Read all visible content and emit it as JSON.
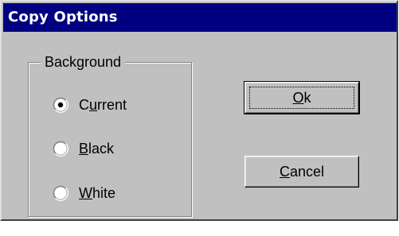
{
  "window": {
    "title": "Copy Options"
  },
  "background_group": {
    "label": "Background",
    "options": [
      {
        "label_mnemonic": "",
        "label_mnemonic_char": "",
        "label_prefix": "C",
        "label_underline": "u",
        "label_suffix": "rrent",
        "selected": true
      },
      {
        "label_prefix": "",
        "label_underline": "B",
        "label_suffix": "lack",
        "selected": false
      },
      {
        "label_prefix": "",
        "label_underline": "W",
        "label_suffix": "hite",
        "selected": false
      }
    ]
  },
  "buttons": {
    "ok": {
      "label_underline": "O",
      "label_suffix": "k"
    },
    "cancel": {
      "label_underline": "C",
      "label_suffix": "ancel"
    }
  },
  "colors": {
    "titlebar": "#000080",
    "face": "#c0c0c0"
  }
}
